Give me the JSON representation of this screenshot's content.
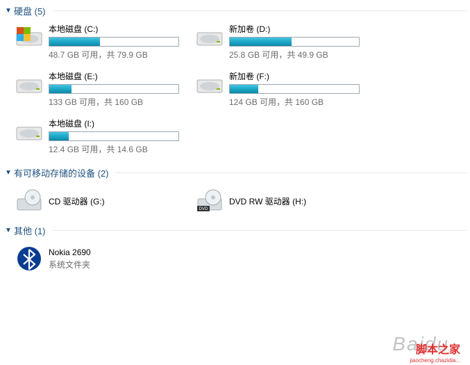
{
  "sections": {
    "hdd": {
      "title": "硬盘 (5)"
    },
    "removable": {
      "title": "有可移动存储的设备 (2)"
    },
    "other": {
      "title": "其他 (1)"
    }
  },
  "drives": [
    {
      "label": "本地磁盘 (C:)",
      "info": "48.7 GB 可用，共 79.9 GB",
      "fillPercent": 39,
      "system": true
    },
    {
      "label": "新加卷 (D:)",
      "info": "25.8 GB 可用，共 49.9 GB",
      "fillPercent": 48,
      "system": false
    },
    {
      "label": "本地磁盘 (E:)",
      "info": "133 GB 可用，共 160 GB",
      "fillPercent": 17,
      "system": false
    },
    {
      "label": "新加卷 (F:)",
      "info": "124 GB 可用，共 160 GB",
      "fillPercent": 22,
      "system": false
    },
    {
      "label": "本地磁盘 (I:)",
      "info": "12.4 GB 可用，共 14.6 GB",
      "fillPercent": 15,
      "system": false
    }
  ],
  "removable": [
    {
      "label": "CD 驱动器 (G:)",
      "type": "cd"
    },
    {
      "label": "DVD RW 驱动器 (H:)",
      "type": "dvd"
    }
  ],
  "other": [
    {
      "label": "Nokia 2690",
      "sub": "系统文件夹",
      "type": "bt"
    }
  ],
  "watermarks": {
    "bg": "Baidu",
    "red1": "脚本之家",
    "red2": "jiaocheng.chazidia..."
  }
}
